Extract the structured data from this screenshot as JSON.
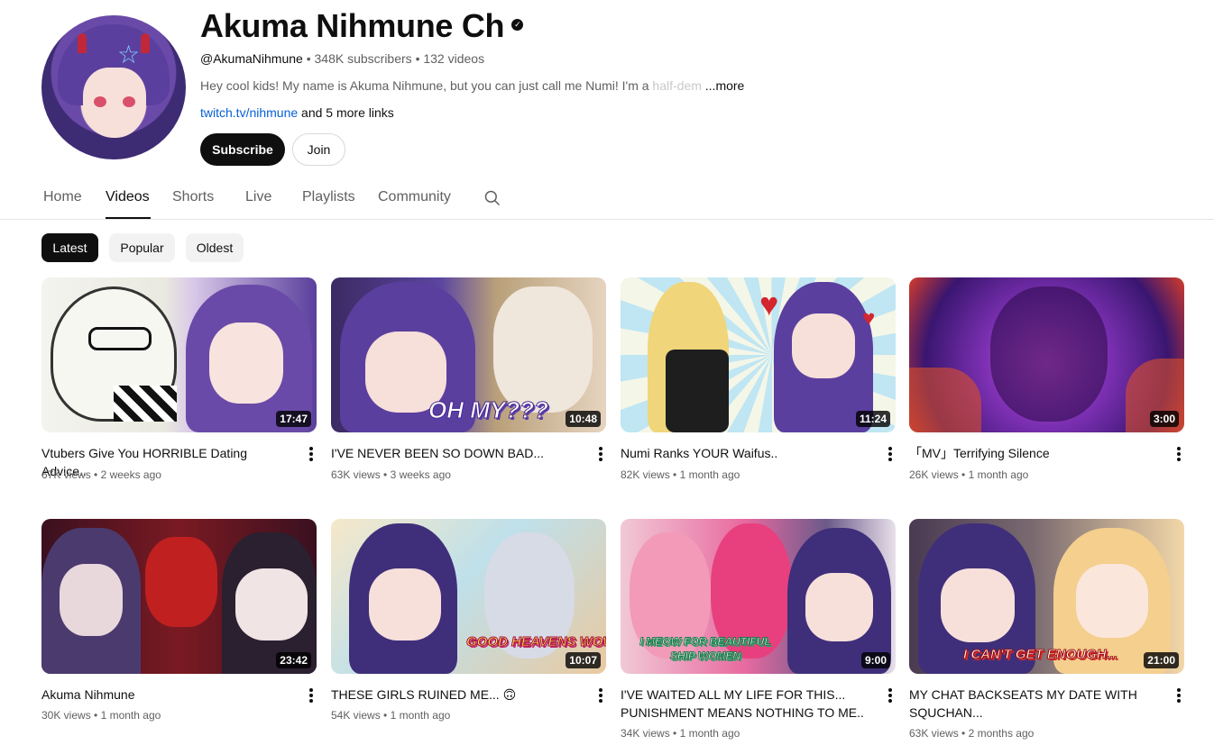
{
  "channel": {
    "name": "Akuma Nihmune Ch",
    "handle": "@AkumaNihmune",
    "subscribers": "348K subscribers",
    "videos": "132 videos",
    "description": "Hey cool kids! My name is Akuma Nihmune, but you can just call me Numi! I'm a ",
    "description_fade": "half-dem",
    "more_label": "...more",
    "link": "twitch.tv/nihmune",
    "more_links": " and 5 more links",
    "subscribe_label": "Subscribe",
    "join_label": "Join"
  },
  "tabs": [
    "Home",
    "Videos",
    "Shorts",
    "Live",
    "Playlists",
    "Community"
  ],
  "chips": [
    "Latest",
    "Popular",
    "Oldest"
  ],
  "videos": [
    {
      "title": "Vtubers Give You HORRIBLE Dating Advice..",
      "views": "67K views",
      "age": "2 weeks ago",
      "duration": "17:47"
    },
    {
      "title": "I'VE NEVER BEEN SO DOWN BAD...",
      "views": "63K views",
      "age": "3 weeks ago",
      "duration": "10:48",
      "overlay": "OH MY???"
    },
    {
      "title": "Numi Ranks YOUR Waifus..",
      "views": "82K views",
      "age": "1 month ago",
      "duration": "11:24"
    },
    {
      "title": "「MV」Terrifying Silence",
      "views": "26K views",
      "age": "1 month ago",
      "duration": "3:00"
    },
    {
      "title": "Akuma Nihmune",
      "views": "30K views",
      "age": "1 month ago",
      "duration": "23:42"
    },
    {
      "title": "THESE GIRLS RUINED ME... 🙃",
      "views": "54K views",
      "age": "1 month ago",
      "duration": "10:07",
      "overlay": "GOOD HEAVENS WOW! OMG"
    },
    {
      "title": "I'VE WAITED ALL MY LIFE FOR THIS... PUNISHMENT MEANS NOTHING TO ME..",
      "views": "34K views",
      "age": "1 month ago",
      "duration": "9:00",
      "overlay": "I MEOW FOR BEAUTIFUL SHIP WOMEN"
    },
    {
      "title": "MY CHAT BACKSEATS MY DATE WITH SQUCHAN...",
      "views": "63K views",
      "age": "2 months ago",
      "duration": "21:00",
      "overlay": "I CAN'T GET ENOUGH..."
    }
  ],
  "colors": {
    "accent": "#0f0f0f",
    "link": "#065fd4",
    "secondary_text": "#606060"
  }
}
